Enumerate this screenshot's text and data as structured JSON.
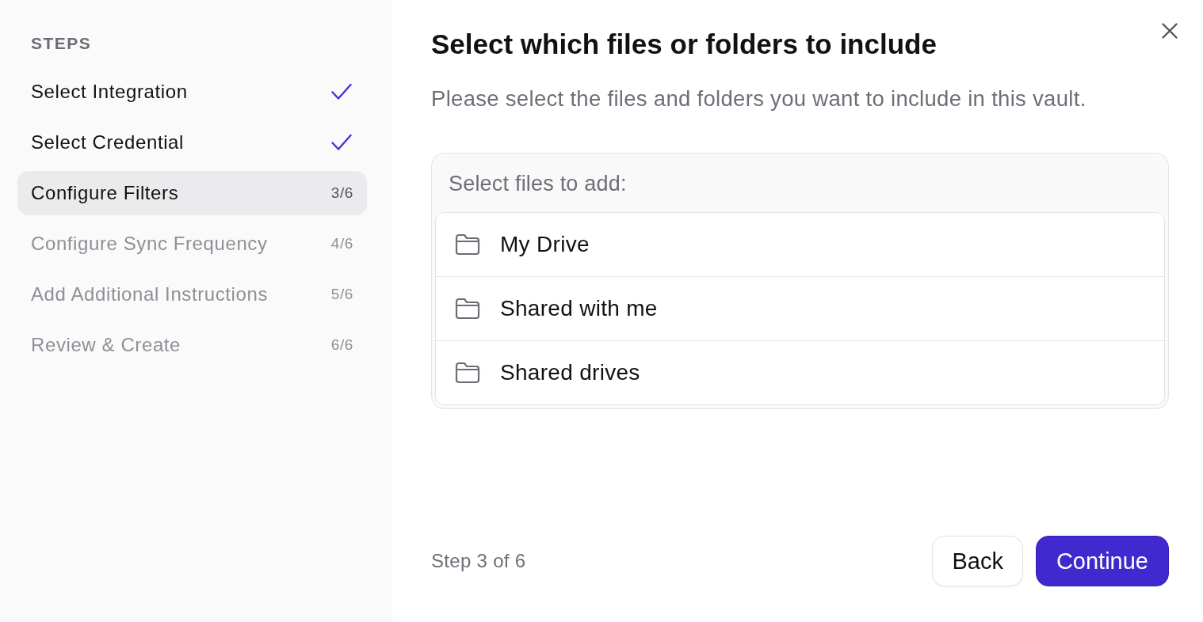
{
  "sidebar": {
    "heading": "STEPS",
    "steps": [
      {
        "label": "Select Integration",
        "completed": true,
        "selected": false
      },
      {
        "label": "Select Credential",
        "completed": true,
        "selected": false
      },
      {
        "label": "Configure Filters",
        "counter": "3/6",
        "completed": false,
        "selected": true
      },
      {
        "label": "Configure Sync Frequency",
        "counter": "4/6",
        "completed": false,
        "selected": false
      },
      {
        "label": "Add Additional Instructions",
        "counter": "5/6",
        "completed": false,
        "selected": false
      },
      {
        "label": "Review & Create",
        "counter": "6/6",
        "completed": false,
        "selected": false
      }
    ]
  },
  "dialog": {
    "title": "Select which files or folders to include",
    "subtitle": "Please select the files and folders you want to include in this vault."
  },
  "file_picker": {
    "label": "Select files to add:",
    "items": [
      {
        "label": "My Drive"
      },
      {
        "label": "Shared with me"
      },
      {
        "label": "Shared drives"
      }
    ]
  },
  "footer": {
    "step_text": "Step 3 of 6",
    "buttons": [
      {
        "label": "Back",
        "kind": "secondary"
      },
      {
        "label": "Continue",
        "kind": "primary"
      }
    ]
  }
}
